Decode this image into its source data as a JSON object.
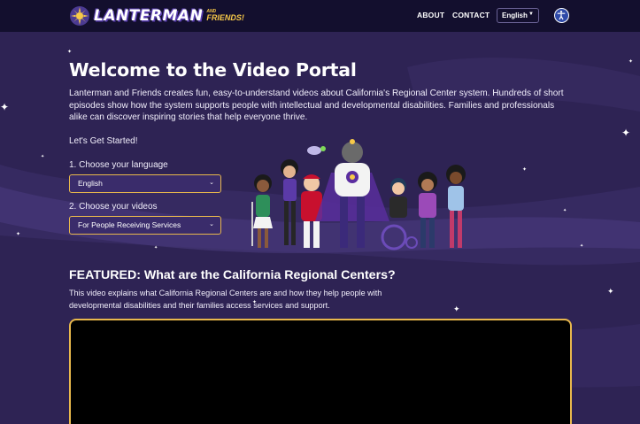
{
  "header": {
    "brand_word": "LANTERMAN",
    "brand_and": "AND",
    "brand_friends": "FRIENDS!",
    "nav": [
      {
        "label": "ABOUT"
      },
      {
        "label": "CONTACT"
      }
    ],
    "language": "English",
    "accessibility_icon": "accessibility-icon"
  },
  "hero": {
    "title": "Welcome to the Video Portal",
    "intro": "Lanterman and Friends creates fun, easy-to-understand videos about California's Regional Center system. Hundreds of short episodes show how the system supports people with intellectual and developmental disabilities. Families and professionals alike can discover inspiring stories that help everyone thrive.",
    "lets_start": "Let's Get Started!",
    "step1_label": "1. Choose your language",
    "step1_value": "English",
    "step2_label": "2. Choose your videos",
    "step2_value": "For People Receiving Services"
  },
  "featured": {
    "title": "FEATURED: What are the California Regional Centers?",
    "description": "This video explains what California Regional Centers are and how they help people with developmental disabilities and their families access services and support."
  },
  "colors": {
    "header_bg": "#130f2e",
    "page_bg": "#2e2354",
    "accent_gold": "#e8b84c",
    "select_bg": "#3a2c6b"
  }
}
